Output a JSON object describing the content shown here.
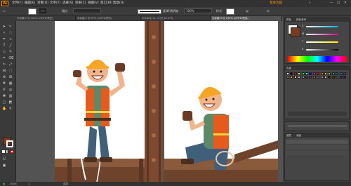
{
  "app": {
    "logo_text": "Ai",
    "workspace_name": "基本功能"
  },
  "menubar": {
    "items": [
      "文件(F)",
      "编辑(E)",
      "对象(O)",
      "文字(T)",
      "选择(S)",
      "效果(C)",
      "视图(V)",
      "窗口(W)",
      "帮助(H)"
    ]
  },
  "controlbar": {
    "opacity_label": "不透明度",
    "opacity_value": "100%",
    "style_label": "样式",
    "stroke_label": "描边",
    "shape_label": "基本"
  },
  "tabs": [
    {
      "label": "未标题-1 @ 200% (CMYK/预览)"
    },
    {
      "label": "未标题-2 @ 97% (CMYK/预览)"
    },
    {
      "label": "20180413/...ai @ 66.67%"
    },
    {
      "label": "未标题-3 @ 200% (CMYK/预览)"
    }
  ],
  "status": {
    "zoom": "200%",
    "tool": "选择",
    "page": "1"
  },
  "colors": {
    "accent": "#ff9a00",
    "helmet": "#f6a623",
    "vest": "#e85a1c",
    "shirt": "#5b8a6a",
    "jeans": "#3f5f7a",
    "beam": "#8a5a3c"
  },
  "panels": {
    "color_tabs": [
      "颜色",
      "颜色参考"
    ],
    "cmyk_labels": [
      "C",
      "M",
      "Y",
      "K"
    ],
    "swatches_tab": "色板",
    "layers_tabs": [
      "图层",
      "画板"
    ]
  }
}
